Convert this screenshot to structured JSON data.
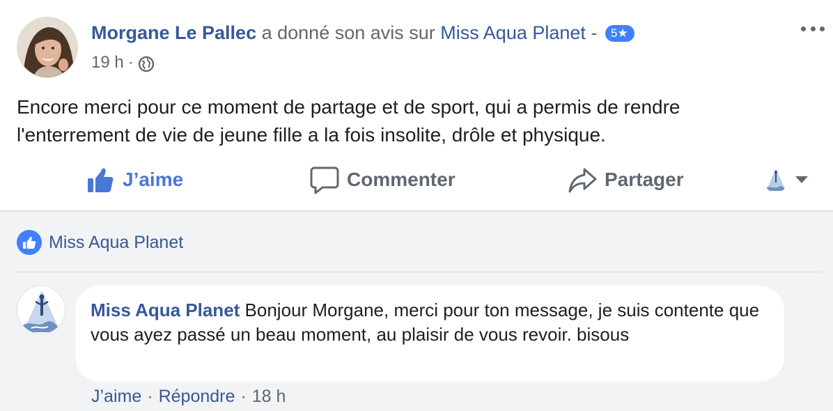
{
  "post": {
    "author": "Morgane Le Pallec",
    "reviewed_text": "a donné son avis sur",
    "page_name": "Miss Aqua Planet",
    "dash": "-",
    "rating": "5★",
    "time": "19 h",
    "meta_dot": "·",
    "text": "Encore merci pour ce moment de partage et de sport, qui a permis de rendre l'enterrement de vie de jeune fille a la fois insolite, drôle et physique."
  },
  "actions": {
    "like": "J’aime",
    "comment": "Commenter",
    "share": "Partager"
  },
  "likes": {
    "name": "Miss Aqua Planet"
  },
  "comment": {
    "author": "Miss Aqua Planet",
    "text": "Bonjour Morgane, merci pour ton message, je suis contente que vous ayez passé un beau moment, au plaisir de vous revoir. bisous",
    "like": "J’aime",
    "reply": "Répondre",
    "time": "18 h",
    "dot": "·"
  },
  "icons": {
    "more": "more-options-icon",
    "globe": "globe-icon",
    "like": "thumbs-up-icon",
    "comment": "speech-bubble-icon",
    "share": "share-arrow-icon",
    "caret": "caret-down-icon"
  },
  "colors": {
    "link": "#365899",
    "like_blue": "#4a76d6",
    "badge_blue": "#4080ff",
    "secondary_text": "#606770",
    "comment_bg": "#f2f3f5"
  }
}
